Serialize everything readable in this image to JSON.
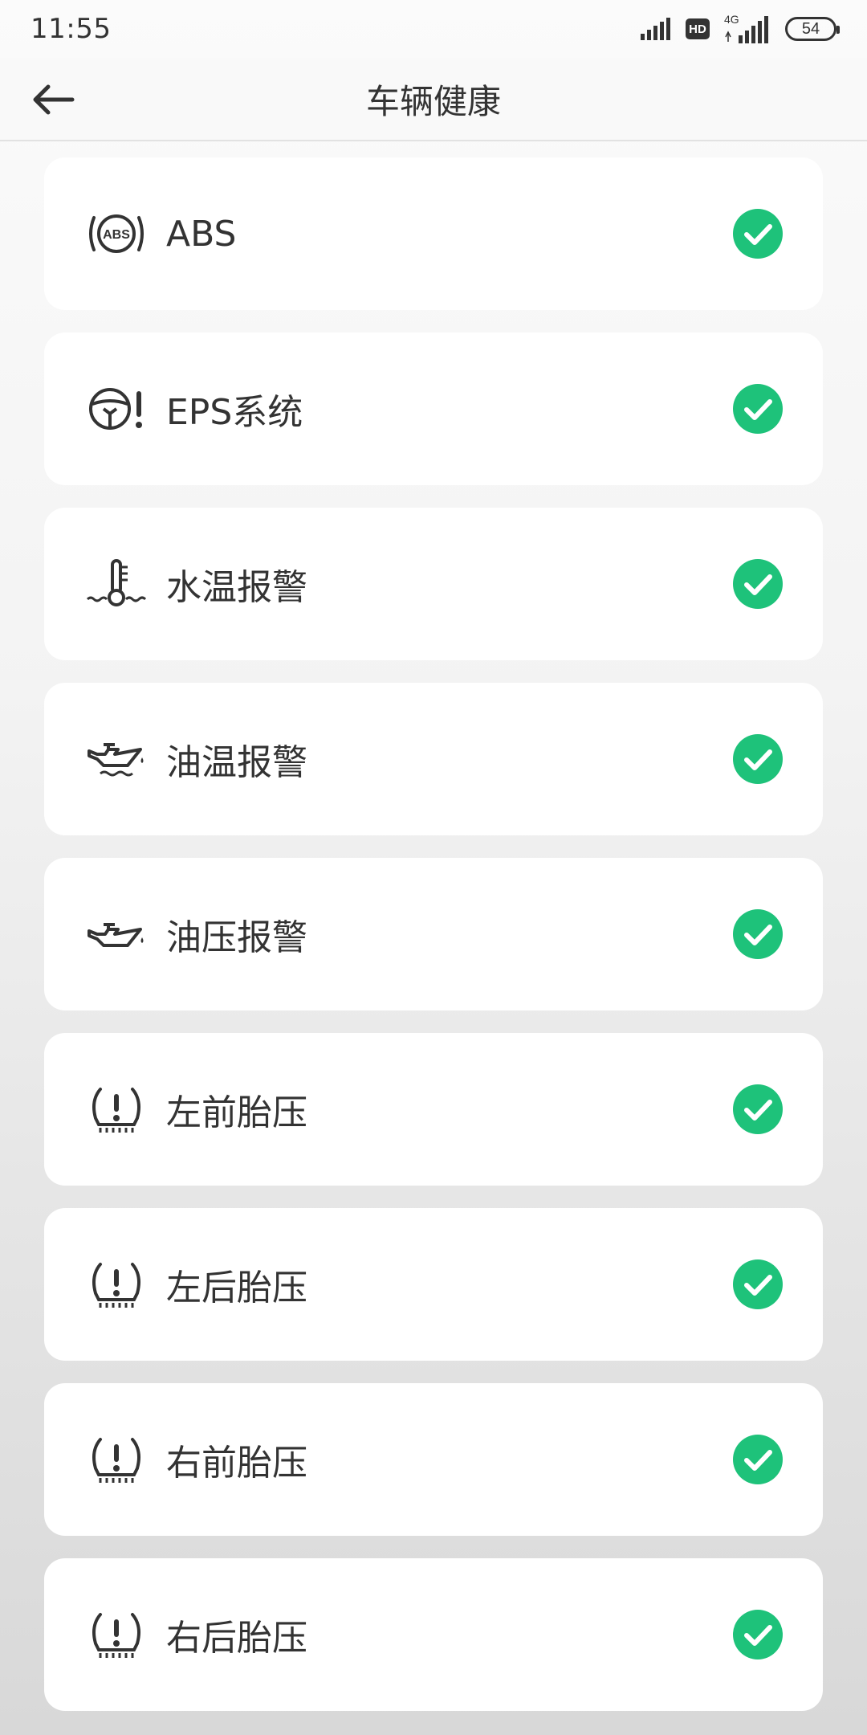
{
  "status_bar": {
    "time": "11:55",
    "network_label": "4G",
    "hd_label": "HD",
    "battery": "54"
  },
  "header": {
    "title": "车辆健康"
  },
  "colors": {
    "ok_green": "#1ec27a",
    "text_dark": "#333333"
  },
  "items": [
    {
      "label": "ABS",
      "icon": "abs-icon",
      "status": "ok"
    },
    {
      "label": "EPS系统",
      "icon": "steering-warning-icon",
      "status": "ok"
    },
    {
      "label": "水温报警",
      "icon": "coolant-temperature-icon",
      "status": "ok"
    },
    {
      "label": "油温报警",
      "icon": "oil-temperature-icon",
      "status": "ok"
    },
    {
      "label": "油压报警",
      "icon": "oil-pressure-icon",
      "status": "ok"
    },
    {
      "label": "左前胎压",
      "icon": "tire-pressure-icon",
      "status": "ok"
    },
    {
      "label": "左后胎压",
      "icon": "tire-pressure-icon",
      "status": "ok"
    },
    {
      "label": "右前胎压",
      "icon": "tire-pressure-icon",
      "status": "ok"
    },
    {
      "label": "右后胎压",
      "icon": "tire-pressure-icon",
      "status": "ok"
    }
  ]
}
